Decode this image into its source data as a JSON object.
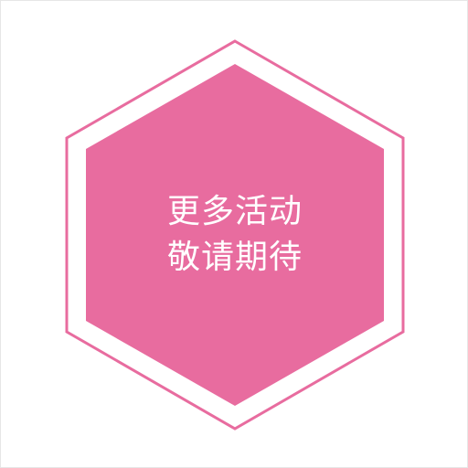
{
  "badge": {
    "line1": "更多活动",
    "line2": "敬请期待"
  },
  "colors": {
    "accent": "#e86c9f",
    "text": "#ffffff",
    "frame_border": "#e6e6e6",
    "background": "#ffffff"
  }
}
